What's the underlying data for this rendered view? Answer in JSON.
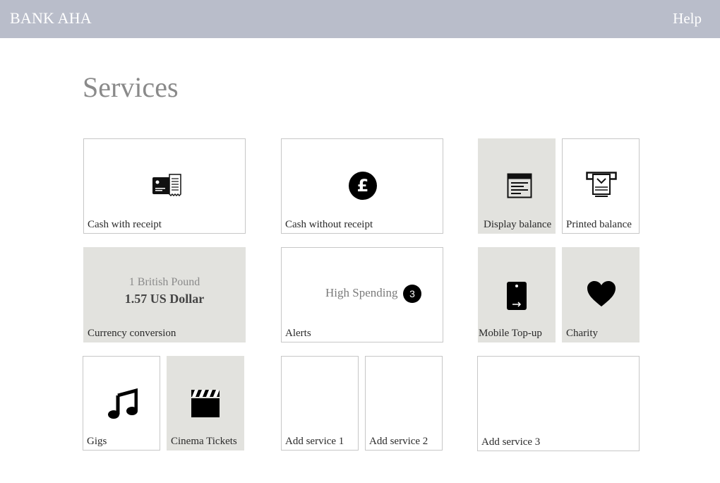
{
  "header": {
    "brand": "BANK AHA",
    "help_label": "Help"
  },
  "page": {
    "title": "Services"
  },
  "tiles": {
    "cash_with_receipt": {
      "label": "Cash with receipt",
      "icon": "card-receipt-icon"
    },
    "cash_without_receipt": {
      "label": "Cash without receipt",
      "icon": "pound-coin-icon"
    },
    "display_balance": {
      "label": "Display balance",
      "icon": "screen-display-icon"
    },
    "printed_balance": {
      "label": "Printed balance",
      "icon": "printer-icon"
    },
    "currency_conversion": {
      "label": "Currency conversion",
      "from_text": "1 British Pound",
      "to_text": "1.57 US Dollar"
    },
    "alerts": {
      "label": "Alerts",
      "alert_text": "High Spending",
      "count": "3"
    },
    "mobile_topup": {
      "label": "Mobile Top-up",
      "icon": "mobile-phone-icon"
    },
    "charity": {
      "label": "Charity",
      "icon": "heart-icon"
    },
    "gigs": {
      "label": "Gigs",
      "icon": "music-note-icon"
    },
    "cinema_tickets": {
      "label": "Cinema Tickets",
      "icon": "clapperboard-icon"
    },
    "add_service_1": {
      "label": "Add service 1"
    },
    "add_service_2": {
      "label": "Add service 2"
    },
    "add_service_3": {
      "label": "Add service 3"
    }
  },
  "colors": {
    "header_bg": "#b9bdca",
    "tile_grey": "#e2e2de",
    "tile_border": "#c7c7c7",
    "title_grey": "#8a8a8a"
  }
}
